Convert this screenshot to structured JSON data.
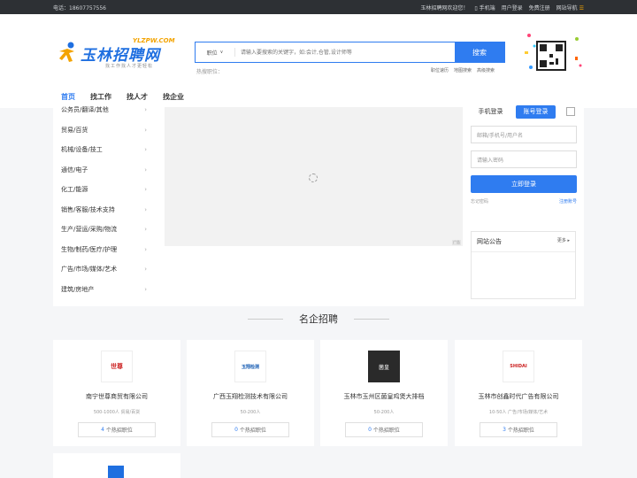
{
  "topbar": {
    "phone": "电话：18607757556",
    "welcome": "玉林招聘网欢迎您！",
    "mobile": "手机端",
    "login": "用户登录",
    "register": "免费注册",
    "sitenav": "网站导航"
  },
  "logo": {
    "text": "玉林招聘网",
    "domain": "YLZPW.COM",
    "slogan": "找工作找人才更轻松"
  },
  "search": {
    "select": "职位",
    "placeholder": "请输入要搜索的关键字，如:会计,仓管,设计师等",
    "button": "搜索",
    "hot_label": "热搜职位："
  },
  "header_links": [
    "职位速历",
    "地图搜索",
    "高级搜索"
  ],
  "nav": [
    "首页",
    "找工作",
    "找人才",
    "找企业"
  ],
  "categories": [
    "公务员/翻译/其他",
    "贸易/百货",
    "机械/设备/技工",
    "通信/电子",
    "化工/能源",
    "销售/客服/技术支持",
    "生产/营运/采购/物流",
    "生物/制药/医疗/护理",
    "广告/市场/媒体/艺术",
    "建筑/房地产"
  ],
  "banner": {
    "ad": "广告"
  },
  "login": {
    "tab_phone": "手机登录",
    "tab_account": "账号登录",
    "user_placeholder": "邮箱/手机号/用户名",
    "pwd_placeholder": "请输入密码",
    "submit": "立即登录",
    "forgot": "忘记密码",
    "signup": "注册账号"
  },
  "notice": {
    "title": "网站公告",
    "more": "更多"
  },
  "section": {
    "title": "名企招聘"
  },
  "companies": [
    {
      "name": "南宁世尊商贸有限公司",
      "meta": "500-1000人  贸易/百货",
      "jobs": "4",
      "jobs_label": "个热招职位",
      "logo_text": "世尊"
    },
    {
      "name": "广西玉翔检测技术有限公司",
      "meta": "50-200人",
      "jobs": "0",
      "jobs_label": "个热招职位",
      "logo_text": "玉翔检测"
    },
    {
      "name": "玉林市玉州区菌皇鸡煲大排档",
      "meta": "50-200人",
      "jobs": "0",
      "jobs_label": "个热招职位",
      "logo_text": "菌皇"
    },
    {
      "name": "玉林市创鑫时代广告有限公司",
      "meta": "10-50人  广告/市场/媒体/艺术",
      "jobs": "3",
      "jobs_label": "个热招职位",
      "logo_text": "SHIDAI"
    }
  ],
  "colors": {
    "accent": "#2f7cf0",
    "topbar": "#2d3034",
    "logo_orange": "#f3a300"
  }
}
